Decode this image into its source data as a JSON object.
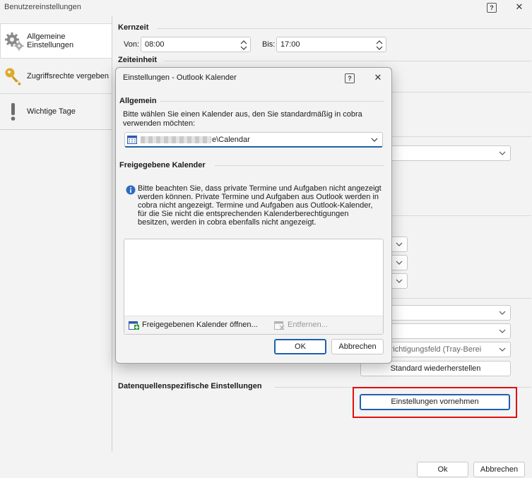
{
  "window": {
    "title": "Benutzereinstellungen",
    "help_glyph": "?",
    "close_glyph": "✕"
  },
  "sidebar": {
    "items": [
      {
        "label": "Allgemeine Einstellungen",
        "icon": "gear-icon"
      },
      {
        "label": "Zugriffsrechte vergeben",
        "icon": "key-icon"
      },
      {
        "label": "Wichtige Tage",
        "icon": "exclamation-icon"
      }
    ]
  },
  "main": {
    "kernzeit": {
      "heading": "Kernzeit",
      "von_label": "Von:",
      "von_value": "08:00",
      "bis_label": "Bis:",
      "bis_value": "17:00"
    },
    "zeiteinheit": {
      "heading": "Zeiteinheit"
    },
    "tray_combo_value": "chrichtigungsfeld (Tray-Berei",
    "reset_button": "Standard wiederherstellen",
    "datasource": {
      "heading": "Datenquellenspezifische Einstellungen",
      "settings_button": "Einstellungen vornehmen"
    }
  },
  "footer": {
    "ok": "Ok",
    "cancel": "Abbrechen"
  },
  "dialog": {
    "title": "Einstellungen - Outlook Kalender",
    "help_glyph": "?",
    "close_glyph": "✕",
    "allgemein_heading": "Allgemein",
    "allgemein_text": "Bitte wählen Sie einen Kalender aus, den Sie standardmäßig in cobra verwenden möchten:",
    "calendar_value": "e\\Calendar",
    "shared_heading": "Freigegebene Kalender",
    "info_text": "Bitte beachten Sie, dass private Termine und Aufgaben nicht angezeigt werden können. Private Termine und Aufgaben aus Outlook werden in cobra nicht angezeigt. Termine und Aufgaben aus Outlook-Kalender, für die Sie nicht die entsprechenden Kalenderberechtigungen besitzen, werden in cobra ebenfalls nicht angezeigt.",
    "open_shared": "Freigegebenen Kalender öffnen...",
    "remove": "Entfernen...",
    "ok": "OK",
    "cancel": "Abbrechen"
  },
  "colors": {
    "accent": "#1f5fae",
    "highlight": "#e01010",
    "background": "#f3f3f3"
  }
}
